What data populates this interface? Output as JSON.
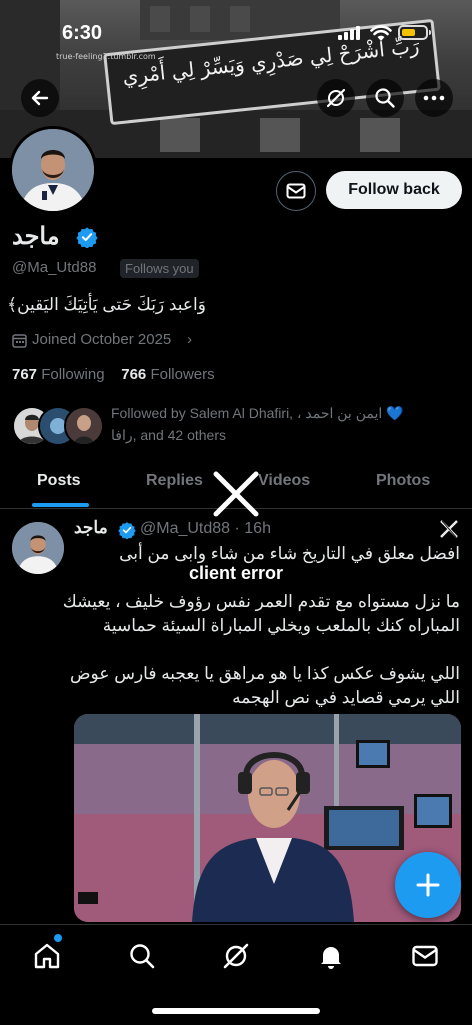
{
  "status_bar": {
    "time": "6:30"
  },
  "banner": {
    "sign_text": "رَبِّ اشْرَحْ لِي صَدْرِي وَيَسِّرْ لِي أَمْرِي",
    "watermark": "true-feeling1.tumblr.com"
  },
  "header": {
    "back_icon": "arrow-left-icon",
    "grok_icon": "grok-icon",
    "search_icon": "search-icon",
    "more_icon": "more-icon"
  },
  "profile": {
    "display_name": "ماجد",
    "handle": "@Ma_Utd88",
    "follows_you": "Follows you",
    "bio": "وَاعبد رَبَكَ حَتى يَأتِيَكَ اليَقين﴾",
    "joined": "Joined October 2025",
    "following_count": "767",
    "following_label": "Following",
    "followers_count": "766",
    "followers_label": "Followers",
    "followed_by": "Followed by Salem Al Dhafiri, ، ايمن بن احمد 💙",
    "followed_by_2": "رافا, and 42 others",
    "follow_back_label": "Follow back",
    "accent_color": "#1d9bf0"
  },
  "tabs": [
    {
      "label": "Posts"
    },
    {
      "label": "Replies"
    },
    {
      "label": "Videos"
    },
    {
      "label": "Photos"
    }
  ],
  "error": {
    "text": "client error"
  },
  "post": {
    "author": "ماجد",
    "handle": "@Ma_Utd88",
    "time": "16h",
    "line1": "افضل معلق في التاريخ شاء من شاء وابى من أبى",
    "line2": "ما نزل مستواه مع تقدم العمر نفس رؤوف خليف ، يعيشك",
    "line3": "المباراه كنك بالملعب ويخلي المباراة السيئة حماسية",
    "line4": "اللي يشوف عكس كذا يا هو مراهق يا يعجبه فارس عوض",
    "line5": "اللي يرمي قصايد في نص الهجمه"
  },
  "bottom_nav": [
    {
      "icon": "home-icon"
    },
    {
      "icon": "search-icon"
    },
    {
      "icon": "grok-icon"
    },
    {
      "icon": "notifications-icon"
    },
    {
      "icon": "messages-icon"
    }
  ]
}
